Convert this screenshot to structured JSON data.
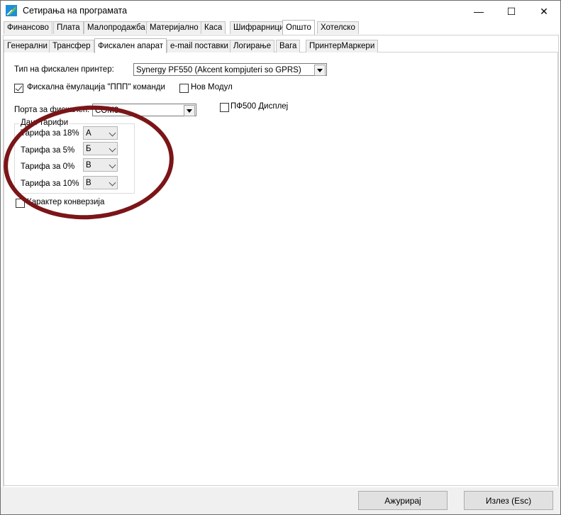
{
  "window": {
    "title": "Сетирања на програмата",
    "minimize": "—",
    "maximize": "☐",
    "close": "✕"
  },
  "main_tabs": [
    "Финансово",
    "Плата",
    "Малопродажба",
    "Материјално",
    "Каса",
    "Шифрарници",
    "Општо",
    "Хотелско"
  ],
  "main_tabs_active": "Општо",
  "sub_tabs": [
    "Генерални",
    "Трансфер",
    "Фискален апарат",
    "e-mail поставки",
    "Логирање",
    "Вага",
    "ПринтерМаркери"
  ],
  "sub_tabs_active": "Фискален апарат",
  "fiscal": {
    "printer_type_label": "Тип на фискален принтер:",
    "printer_type_value": "Synergy PF550 (Akcent kompjuteri so GPRS)",
    "fiscal_commands_label": "Фискална ёмулација \"ППП\" команди",
    "fiscal_commands_checked": true,
    "new_module_label": "Нов Модул",
    "new_module_checked": false,
    "port_label": "Порта за фискален:",
    "port_value": "COM3",
    "pf500_display_label": "ПФ500 Дисплеј",
    "pf500_display_checked": false,
    "tariffs_group_title": "Дан. тарифи",
    "tariffs": [
      {
        "label": "Тарифа за 18%",
        "value": "А"
      },
      {
        "label": "Тарифа за 5%",
        "value": "Б"
      },
      {
        "label": "Тарифа за 0%",
        "value": "В"
      },
      {
        "label": "Тарифа за 10%",
        "value": "В"
      }
    ],
    "char_conversion_label": "Карактер конверзија",
    "char_conversion_checked": false
  },
  "buttons": {
    "update": "Ажурирај",
    "exit": "Излез (Esc)"
  },
  "colors": {
    "annotation_ring": "#7b1518"
  }
}
